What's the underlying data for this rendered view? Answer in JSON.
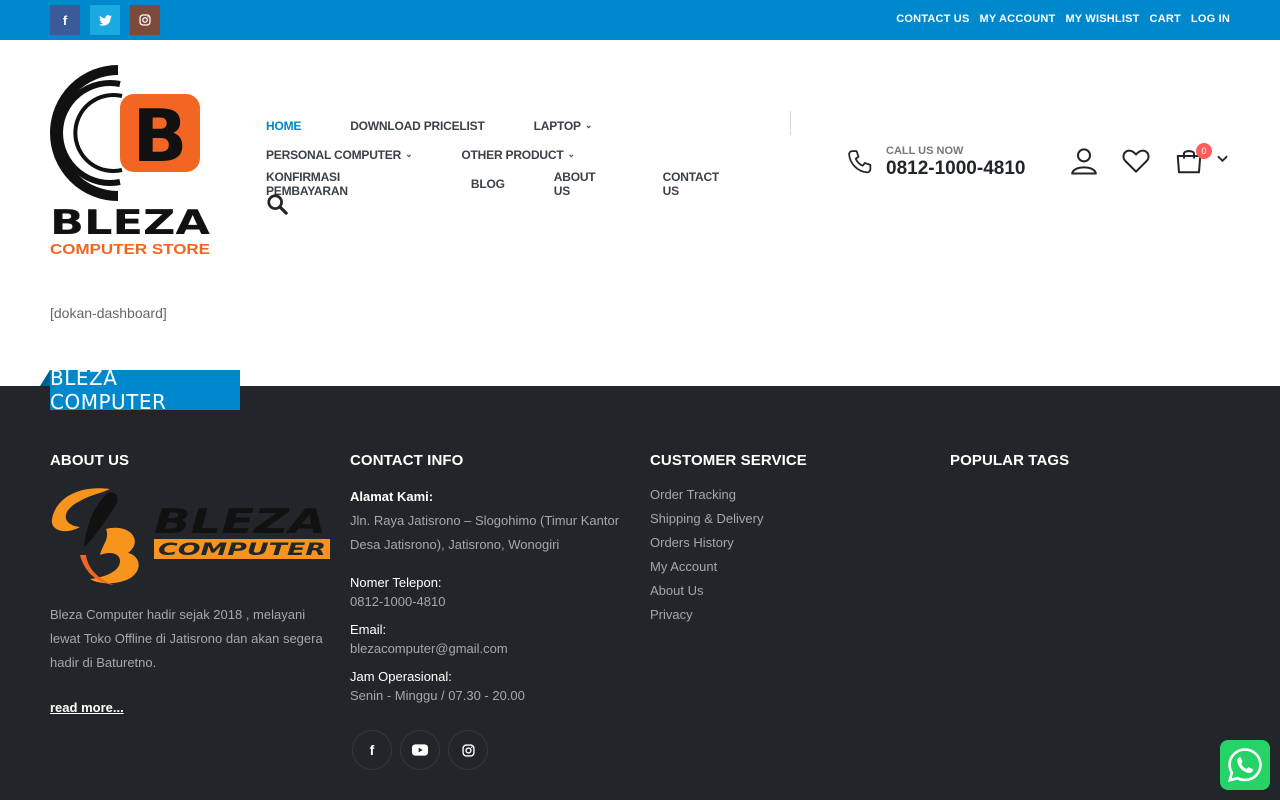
{
  "topbar": {
    "social": [
      {
        "name": "facebook",
        "glyph": "f",
        "icon": "facebook-icon"
      },
      {
        "name": "twitter",
        "glyph": "t",
        "icon": "twitter-icon"
      },
      {
        "name": "instagram",
        "glyph": "◎",
        "icon": "instagram-icon"
      }
    ],
    "links": [
      "CONTACT US",
      "MY ACCOUNT",
      "MY WISHLIST",
      "CART",
      "LOG IN"
    ],
    "bg_color": "#0088cc"
  },
  "logo": {
    "brand": "BLEZA",
    "tagline": "COMPUTER STORE",
    "letter": "B",
    "accent_color": "#f26522"
  },
  "nav": {
    "rows": [
      [
        {
          "label": "HOME",
          "active": true,
          "dropdown": false
        },
        {
          "label": "DOWNLOAD PRICELIST",
          "active": false,
          "dropdown": false
        },
        {
          "label": "LAPTOP",
          "active": false,
          "dropdown": true
        }
      ],
      [
        {
          "label": "PERSONAL COMPUTER",
          "active": false,
          "dropdown": true
        },
        {
          "label": "OTHER PRODUCT",
          "active": false,
          "dropdown": true
        }
      ],
      [
        {
          "label": "KONFIRMASI PEMBAYARAN",
          "active": false,
          "dropdown": false
        },
        {
          "label": "BLOG",
          "active": false,
          "dropdown": false
        },
        {
          "label": "ABOUT US",
          "active": false,
          "dropdown": false
        },
        {
          "label": "CONTACT US",
          "active": false,
          "dropdown": false
        }
      ]
    ]
  },
  "header": {
    "call_label": "CALL US NOW",
    "phone": "0812-1000-4810",
    "cart_count": "0"
  },
  "main": {
    "shortcode": "[dokan-dashboard]"
  },
  "footer": {
    "ribbon": "BLEZA COMPUTER",
    "about": {
      "title": "ABOUT US",
      "logo_brand": "BLEZA",
      "logo_sub": "COMPUTER",
      "text": "Bleza Computer hadir sejak 2018 , melayani lewat Toko Offline di Jatisrono dan akan segera hadir di Baturetno.",
      "read_more": "read more..."
    },
    "contact": {
      "title": "CONTACT INFO",
      "address_label": "Alamat Kami:",
      "address": "Jln. Raya Jatisrono – Slogohimo (Timur Kantor Desa Jatisrono), Jatisrono, Wonogiri",
      "phone_label": "Nomer Telepon:",
      "phone": "0812-1000-4810",
      "email_label": "Email:",
      "email": "blezacomputer@gmail.com",
      "hours_label": "Jam Operasional:",
      "hours": "Senin - Minggu / 07.30 - 20.00",
      "social": [
        {
          "name": "facebook",
          "glyph": "f"
        },
        {
          "name": "youtube",
          "glyph": "▶"
        },
        {
          "name": "instagram",
          "glyph": "◎"
        }
      ]
    },
    "service": {
      "title": "CUSTOMER SERVICE",
      "links": [
        "Order Tracking",
        "Shipping & Delivery",
        "Orders History",
        "My Account",
        "About Us",
        "Privacy"
      ]
    },
    "tags": {
      "title": "POPULAR TAGS"
    },
    "bg_color": "#222529"
  },
  "whatsapp": {
    "icon": "whatsapp-icon",
    "color": "#25d366"
  }
}
